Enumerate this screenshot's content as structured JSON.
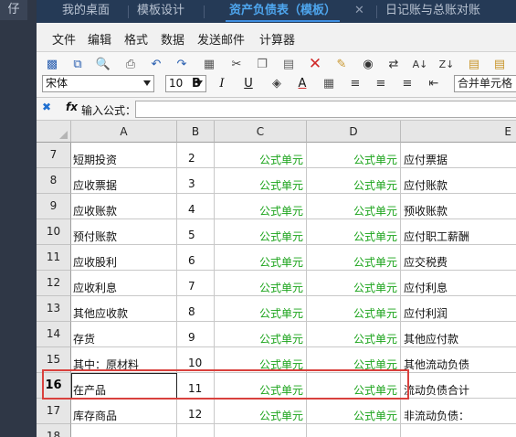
{
  "left_rail": {
    "glyph": "仔"
  },
  "tabs": [
    {
      "label": "我的桌面",
      "active": false
    },
    {
      "label": "模板设计",
      "active": false
    },
    {
      "label": "资产负债表（模板）",
      "active": true,
      "close": "✕"
    },
    {
      "label": "日记账与总账对账",
      "active": false
    }
  ],
  "menu": [
    "文件",
    "编辑",
    "格式",
    "数据",
    "发送邮件",
    "计算器"
  ],
  "toolbar": {
    "icons": [
      "save-icon",
      "save-as-icon",
      "print-preview-icon",
      "print-icon",
      "undo-icon",
      "redo-icon",
      "select-all-icon",
      "cut-icon",
      "copy-icon",
      "paste-icon",
      "delete-icon",
      "format-brush-icon",
      "find-icon",
      "replace-icon",
      "sort-ascending-icon",
      "sort-descending-icon",
      "clipboard-icon",
      "paste-special-icon"
    ],
    "font_name": "宋体",
    "font_size": "10",
    "bold": "B",
    "italic": "I",
    "underline": "U",
    "font_color": "A",
    "merge_label": "合并单元格"
  },
  "formula_bar": {
    "label": "输入公式：",
    "fx": "fx",
    "value": ""
  },
  "columns": [
    "A",
    "B",
    "C",
    "D",
    "E"
  ],
  "rows": [
    {
      "num": "7",
      "a": "短期投资",
      "b": "2",
      "c": "公式单元",
      "d": "公式单元",
      "e": "应付票据"
    },
    {
      "num": "8",
      "a": "应收票据",
      "b": "3",
      "c": "公式单元",
      "d": "公式单元",
      "e": "应付账款"
    },
    {
      "num": "9",
      "a": "应收账款",
      "b": "4",
      "c": "公式单元",
      "d": "公式单元",
      "e": "预收账款"
    },
    {
      "num": "10",
      "a": "预付账款",
      "b": "5",
      "c": "公式单元",
      "d": "公式单元",
      "e": "应付职工薪酬"
    },
    {
      "num": "11",
      "a": "应收股利",
      "b": "6",
      "c": "公式单元",
      "d": "公式单元",
      "e": "应交税费"
    },
    {
      "num": "12",
      "a": "应收利息",
      "b": "7",
      "c": "公式单元",
      "d": "公式单元",
      "e": "应付利息"
    },
    {
      "num": "13",
      "a": "其他应收款",
      "b": "8",
      "c": "公式单元",
      "d": "公式单元",
      "e": "应付利润"
    },
    {
      "num": "14",
      "a": "存货",
      "b": "9",
      "c": "公式单元",
      "d": "公式单元",
      "e": "其他应付款"
    },
    {
      "num": "15",
      "a": "其中：原材料",
      "b": "10",
      "c": "公式单元",
      "d": "公式单元",
      "e": "其他流动负债"
    },
    {
      "num": "16",
      "a": "在产品",
      "b": "11",
      "c": "公式单元",
      "d": "公式单元",
      "e": "流动负债合计",
      "selected": true
    },
    {
      "num": "17",
      "a": "库存商品",
      "b": "12",
      "c": "公式单元",
      "d": "公式单元",
      "e": "非流动负债："
    },
    {
      "num": "18",
      "a": "",
      "b": "",
      "c": "",
      "d": "",
      "e": ""
    }
  ],
  "colors": {
    "accent": "#3e8ee0",
    "formula_green": "#1aa31a",
    "highlight_red": "#d9413d"
  }
}
